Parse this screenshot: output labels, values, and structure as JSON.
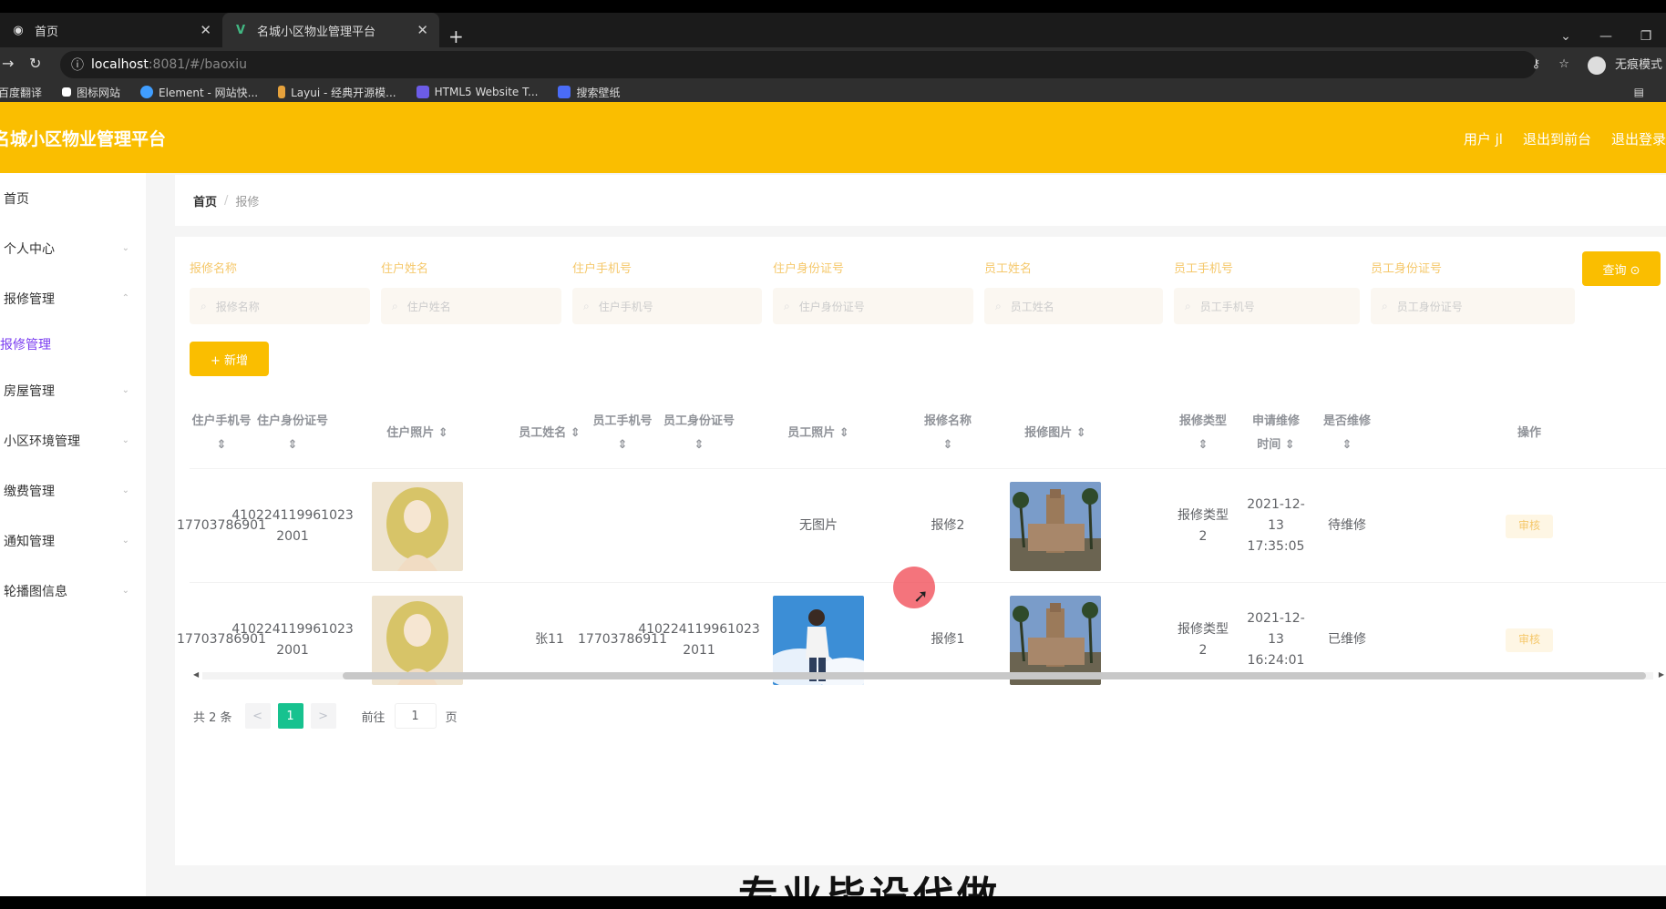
{
  "browser": {
    "tabs": [
      {
        "label": "首页",
        "icon": "globe-icon"
      },
      {
        "label": "名城小区物业管理平台",
        "icon": "vue-icon"
      }
    ],
    "url_host": "localhost",
    "url_path": ":8081/#/baoxiu",
    "profile_label": "无痕模式",
    "bookmarks": [
      {
        "label": "百度翻译",
        "color": "#3b7bf6"
      },
      {
        "label": "图标网站",
        "color": "#ffffff"
      },
      {
        "label": "Element - 网站快...",
        "color": "#409eff"
      },
      {
        "label": "Layui - 经典开源模...",
        "color": "#e6a23c"
      },
      {
        "label": "HTML5 Website T...",
        "color": "#6c5ce7"
      },
      {
        "label": "搜索壁纸",
        "color": "#4a6cf7"
      }
    ]
  },
  "app": {
    "title": "名城小区物业管理平台",
    "header_links": [
      "用户 jl",
      "退出到前台",
      "退出登录"
    ],
    "accent": "#fabe00"
  },
  "sidebar": {
    "items": [
      {
        "label": "首页",
        "chevron": false
      },
      {
        "label": "个人中心",
        "chevron": true
      },
      {
        "label": "报修管理",
        "chevron": true
      },
      {
        "label": "报修管理",
        "chevron": false,
        "sub": true
      },
      {
        "label": "房屋管理",
        "chevron": true
      },
      {
        "label": "小区环境管理",
        "chevron": true
      },
      {
        "label": "缴费管理",
        "chevron": true
      },
      {
        "label": "通知管理",
        "chevron": true
      },
      {
        "label": "轮播图信息",
        "chevron": true
      }
    ]
  },
  "breadcrumb": {
    "home": "首页",
    "sep": "/",
    "current": "报修"
  },
  "filters": [
    {
      "label": "报修名称",
      "placeholder": "报修名称"
    },
    {
      "label": "住户姓名",
      "placeholder": "住户姓名"
    },
    {
      "label": "住户手机号",
      "placeholder": "住户手机号"
    },
    {
      "label": "住户身份证号",
      "placeholder": "住户身份证号"
    },
    {
      "label": "员工姓名",
      "placeholder": "员工姓名"
    },
    {
      "label": "员工手机号",
      "placeholder": "员工手机号"
    },
    {
      "label": "员工身份证号",
      "placeholder": "员工身份证号"
    }
  ],
  "query_button": "查询 ⊙",
  "add_button": "+ 新增",
  "table": {
    "headers": [
      "住户手机号 ⇕",
      "住户身份证号 ⇕",
      "住户照片 ⇕",
      "员工姓名 ⇕",
      "员工手机号 ⇕",
      "员工身份证号 ⇕",
      "员工照片 ⇕",
      "报修名称 ⇕",
      "报修图片 ⇕",
      "报修类型 ⇕",
      "申请维修时间 ⇕",
      "是否维修 ⇕",
      "操作"
    ],
    "rows": [
      {
        "phone": "17703786901",
        "id_card": "410224119961023 2001",
        "emp_name": "",
        "emp_phone": "",
        "emp_id": "",
        "emp_photo_text": "无图片",
        "name": "报修2",
        "type": "报修类型2",
        "time": "2021-12-13 17:35:05",
        "status": "待维修",
        "op": "审核"
      },
      {
        "phone": "17703786901",
        "id_card": "410224119961023 2001",
        "emp_name": "张11",
        "emp_phone": "17703786911",
        "emp_id": "410224119961023 2011",
        "emp_photo_text": "",
        "name": "报修1",
        "type": "报修类型2",
        "time": "2021-12-13 16:24:01",
        "status": "已维修",
        "op": "审核"
      }
    ]
  },
  "pagination": {
    "total": "共 2 条",
    "prev": "<",
    "current": "1",
    "next": ">",
    "goto_label": "前往",
    "goto_value": "1",
    "page_suffix": "页"
  },
  "overlay_text": "专业毕设代做"
}
